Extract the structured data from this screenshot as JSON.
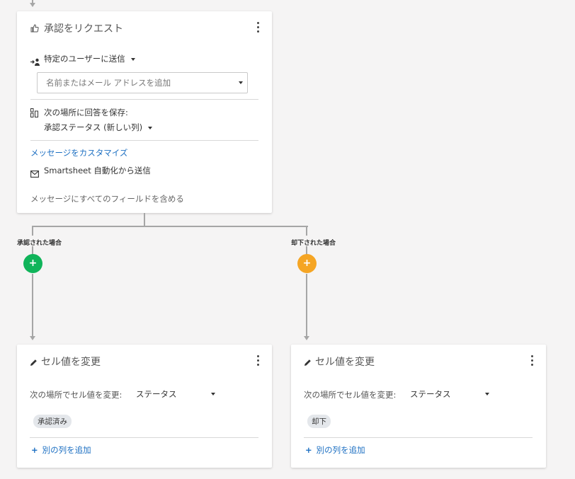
{
  "colors": {
    "approved": "#10b45a",
    "rejected": "#f5a524",
    "link": "#1c6fc2",
    "connector": "#a6a6a6"
  },
  "approval_card": {
    "title": "承認をリクエスト",
    "send_to_label": "特定のユーザーに送信",
    "recipient_placeholder": "名前またはメール アドレスを追加",
    "save_response_label": "次の場所に回答を保存:",
    "save_response_value": "承認ステータス (新しい列)",
    "customize_message_link": "メッセージをカスタマイズ",
    "send_from_label": "Smartsheet 自動化から送信",
    "include_fields_label": "メッセージにすべてのフィールドを含める"
  },
  "branches": {
    "approved_label": "承認された場合",
    "rejected_label": "却下された場合"
  },
  "approved_action": {
    "title": "セル値を変更",
    "change_label": "次の場所でセル値を変更:",
    "column_value": "ステータス",
    "new_value": "承認済み",
    "add_column_link": "別の列を追加"
  },
  "rejected_action": {
    "title": "セル値を変更",
    "change_label": "次の場所でセル値を変更:",
    "column_value": "ステータス",
    "new_value": "却下",
    "add_column_link": "別の列を追加"
  },
  "icons": {
    "plus_glyph": "+",
    "add_glyph": "+"
  }
}
